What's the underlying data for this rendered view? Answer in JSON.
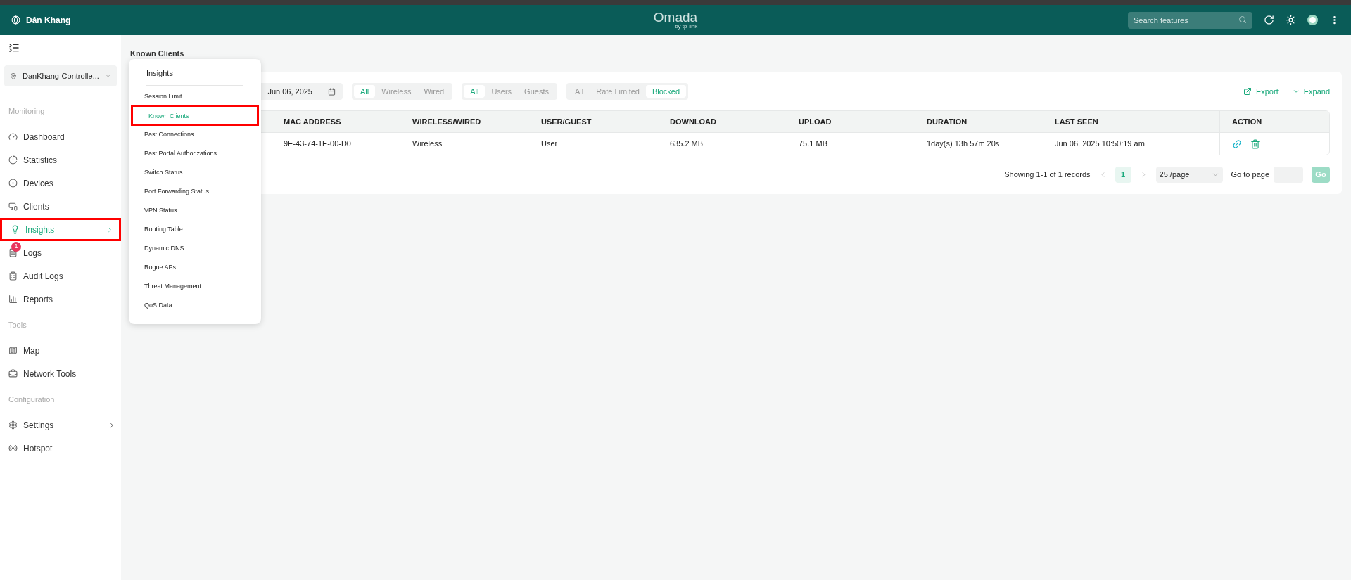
{
  "top_bar": {
    "site": "Dân Khang",
    "logo": "Omada",
    "logo_sub": "by tp-link",
    "search": {
      "placeholder": "Search features"
    }
  },
  "sidebar": {
    "controller": "DanKhang-Controlle...",
    "sections": [
      {
        "title": "Monitoring",
        "items": [
          {
            "label": "Dashboard",
            "selected": false,
            "highlighted": false,
            "submenu": false
          },
          {
            "label": "Statistics",
            "selected": false,
            "highlighted": false,
            "submenu": false
          },
          {
            "label": "Devices",
            "selected": false,
            "highlighted": false,
            "submenu": false
          },
          {
            "label": "Clients",
            "selected": false,
            "highlighted": false,
            "submenu": false
          },
          {
            "label": "Insights",
            "selected": true,
            "highlighted": true,
            "submenu": true
          },
          {
            "label": "Logs",
            "selected": false,
            "highlighted": false,
            "submenu": false,
            "badge": "1"
          },
          {
            "label": "Audit Logs",
            "selected": false,
            "highlighted": false,
            "submenu": false
          },
          {
            "label": "Reports",
            "selected": false,
            "highlighted": false,
            "submenu": false
          }
        ]
      },
      {
        "title": "Tools",
        "items": [
          {
            "label": "Map",
            "selected": false,
            "highlighted": false,
            "submenu": false
          },
          {
            "label": "Network Tools",
            "selected": false,
            "highlighted": false,
            "submenu": false
          }
        ]
      },
      {
        "title": "Configuration",
        "items": [
          {
            "label": "Settings",
            "selected": false,
            "highlighted": false,
            "submenu": true
          },
          {
            "label": "Hotspot",
            "selected": false,
            "highlighted": false,
            "submenu": false
          }
        ]
      }
    ]
  },
  "page_title": "Known Clients",
  "flyout": {
    "title": "Insights",
    "items": [
      {
        "label": "Session Limit",
        "selected": false,
        "highlighted": false
      },
      {
        "label": "Known Clients",
        "selected": true,
        "highlighted": true
      },
      {
        "label": "Past Connections",
        "selected": false,
        "highlighted": false
      },
      {
        "label": "Past Portal Authorizations",
        "selected": false,
        "highlighted": false
      },
      {
        "label": "Switch Status",
        "selected": false,
        "highlighted": false
      },
      {
        "label": "Port Forwarding Status",
        "selected": false,
        "highlighted": false
      },
      {
        "label": "VPN Status",
        "selected": false,
        "highlighted": false
      },
      {
        "label": "Routing Table",
        "selected": false,
        "highlighted": false
      },
      {
        "label": "Dynamic DNS",
        "selected": false,
        "highlighted": false
      },
      {
        "label": "Rogue APs",
        "selected": false,
        "highlighted": false
      },
      {
        "label": "Threat Management",
        "selected": false,
        "highlighted": false
      },
      {
        "label": "QoS Data",
        "selected": false,
        "highlighted": false
      }
    ]
  },
  "filters": {
    "date": "Jun 06, 2025",
    "segments": [
      [
        {
          "label": "All",
          "selected": true
        },
        {
          "label": "Wireless",
          "selected": false
        },
        {
          "label": "Wired",
          "selected": false
        }
      ],
      [
        {
          "label": "All",
          "selected": true
        },
        {
          "label": "Users",
          "selected": false
        },
        {
          "label": "Guests",
          "selected": false
        }
      ],
      [
        {
          "label": "All",
          "selected": false
        },
        {
          "label": "Rate Limited",
          "selected": false
        },
        {
          "label": "Blocked",
          "selected": true
        }
      ]
    ]
  },
  "actions": {
    "export": "Export",
    "expand": "Expand"
  },
  "table": {
    "columns": [
      "MAC ADDRESS",
      "WIRELESS/WIRED",
      "USER/GUEST",
      "DOWNLOAD",
      "UPLOAD",
      "DURATION",
      "LAST SEEN",
      "ACTION"
    ],
    "rows": [
      {
        "cells": [
          "9E-43-74-1E-00-D0",
          "Wireless",
          "User",
          "635.2 MB",
          "75.1 MB",
          "1day(s) 13h 57m 20s",
          "Jun 06, 2025 10:50:19 am"
        ]
      }
    ]
  },
  "pagination": {
    "summary": "Showing 1-1 of 1 records",
    "pages": [
      {
        "label": "1",
        "selected": true
      }
    ],
    "page_size": "25 /page",
    "goto_label": "Go to page",
    "go": "Go"
  }
}
